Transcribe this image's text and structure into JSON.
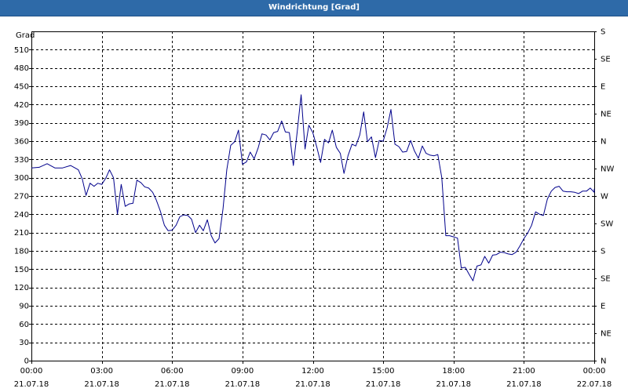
{
  "window": {
    "title": "Windrichtung [Grad]"
  },
  "chart_data": {
    "type": "line",
    "title": "Windrichtung [Grad]",
    "ylabel": "Grad",
    "ylim": [
      0,
      540
    ],
    "y_ticks": [
      0,
      30,
      60,
      90,
      120,
      150,
      180,
      210,
      240,
      270,
      300,
      330,
      360,
      390,
      420,
      450,
      480,
      510
    ],
    "xlim_hours": [
      0,
      24
    ],
    "x_ticks": [
      {
        "h": 0,
        "time": "00:00",
        "date": "21.07.18"
      },
      {
        "h": 3,
        "time": "03:00",
        "date": "21.07.18"
      },
      {
        "h": 6,
        "time": "06:00",
        "date": "21.07.18"
      },
      {
        "h": 9,
        "time": "09:00",
        "date": "21.07.18"
      },
      {
        "h": 12,
        "time": "12:00",
        "date": "21.07.18"
      },
      {
        "h": 15,
        "time": "15:00",
        "date": "21.07.18"
      },
      {
        "h": 18,
        "time": "18:00",
        "date": "21.07.18"
      },
      {
        "h": 21,
        "time": "21:00",
        "date": "21.07.18"
      },
      {
        "h": 24,
        "time": "00:00",
        "date": "22.07.18"
      }
    ],
    "right_axis": [
      {
        "v": 0,
        "label": "N"
      },
      {
        "v": 45,
        "label": "NE"
      },
      {
        "v": 90,
        "label": "E"
      },
      {
        "v": 135,
        "label": "SE"
      },
      {
        "v": 180,
        "label": "S"
      },
      {
        "v": 225,
        "label": "SW"
      },
      {
        "v": 270,
        "label": "W"
      },
      {
        "v": 315,
        "label": "NW"
      },
      {
        "v": 360,
        "label": "N"
      },
      {
        "v": 405,
        "label": "NE"
      },
      {
        "v": 450,
        "label": "E"
      },
      {
        "v": 495,
        "label": "SE"
      },
      {
        "v": 540,
        "label": "S"
      }
    ],
    "grid": true,
    "colors": {
      "line": "#00008b",
      "titlebar": "#2e6aa8"
    },
    "series": [
      {
        "points": [
          [
            0.0,
            316
          ],
          [
            0.33,
            317
          ],
          [
            0.67,
            323
          ],
          [
            1.0,
            316
          ],
          [
            1.33,
            316
          ],
          [
            1.67,
            320
          ],
          [
            2.0,
            313
          ],
          [
            2.17,
            298
          ],
          [
            2.33,
            271
          ],
          [
            2.5,
            291
          ],
          [
            2.67,
            286
          ],
          [
            2.83,
            291
          ],
          [
            3.0,
            289
          ],
          [
            3.17,
            299
          ],
          [
            3.33,
            313
          ],
          [
            3.5,
            300
          ],
          [
            3.67,
            240
          ],
          [
            3.83,
            289
          ],
          [
            4.0,
            253
          ],
          [
            4.17,
            257
          ],
          [
            4.33,
            258
          ],
          [
            4.5,
            296
          ],
          [
            4.67,
            292
          ],
          [
            4.83,
            285
          ],
          [
            5.0,
            283
          ],
          [
            5.17,
            276
          ],
          [
            5.33,
            263
          ],
          [
            5.5,
            245
          ],
          [
            5.67,
            222
          ],
          [
            5.83,
            213
          ],
          [
            6.0,
            214
          ],
          [
            6.17,
            222
          ],
          [
            6.33,
            236
          ],
          [
            6.5,
            239
          ],
          [
            6.67,
            238
          ],
          [
            6.83,
            232
          ],
          [
            7.0,
            210
          ],
          [
            7.17,
            222
          ],
          [
            7.33,
            213
          ],
          [
            7.5,
            231
          ],
          [
            7.67,
            205
          ],
          [
            7.83,
            193
          ],
          [
            8.0,
            200
          ],
          [
            8.17,
            249
          ],
          [
            8.33,
            313
          ],
          [
            8.5,
            353
          ],
          [
            8.67,
            359
          ],
          [
            8.83,
            378
          ],
          [
            9.0,
            322
          ],
          [
            9.17,
            326
          ],
          [
            9.33,
            342
          ],
          [
            9.5,
            331
          ],
          [
            9.67,
            349
          ],
          [
            9.83,
            372
          ],
          [
            10.0,
            370
          ],
          [
            10.17,
            362
          ],
          [
            10.33,
            374
          ],
          [
            10.5,
            376
          ],
          [
            10.67,
            393
          ],
          [
            10.83,
            375
          ],
          [
            11.0,
            374
          ],
          [
            11.17,
            320
          ],
          [
            11.33,
            374
          ],
          [
            11.5,
            436
          ],
          [
            11.67,
            347
          ],
          [
            11.83,
            386
          ],
          [
            12.0,
            374
          ],
          [
            12.17,
            350
          ],
          [
            12.33,
            325
          ],
          [
            12.5,
            363
          ],
          [
            12.67,
            357
          ],
          [
            12.83,
            378
          ],
          [
            13.0,
            350
          ],
          [
            13.17,
            340
          ],
          [
            13.33,
            307
          ],
          [
            13.5,
            336
          ],
          [
            13.67,
            355
          ],
          [
            13.83,
            352
          ],
          [
            14.0,
            370
          ],
          [
            14.17,
            408
          ],
          [
            14.33,
            359
          ],
          [
            14.5,
            367
          ],
          [
            14.67,
            333
          ],
          [
            14.83,
            361
          ],
          [
            15.0,
            360
          ],
          [
            15.17,
            382
          ],
          [
            15.33,
            412
          ],
          [
            15.5,
            355
          ],
          [
            15.67,
            351
          ],
          [
            15.83,
            342
          ],
          [
            16.0,
            343
          ],
          [
            16.17,
            361
          ],
          [
            16.33,
            344
          ],
          [
            16.5,
            332
          ],
          [
            16.67,
            352
          ],
          [
            16.83,
            340
          ],
          [
            17.0,
            337
          ],
          [
            17.17,
            336
          ],
          [
            17.33,
            338
          ],
          [
            17.5,
            300
          ],
          [
            17.67,
            205
          ],
          [
            17.83,
            205
          ],
          [
            18.0,
            203
          ],
          [
            18.17,
            201
          ],
          [
            18.33,
            152
          ],
          [
            18.5,
            153
          ],
          [
            18.67,
            141
          ],
          [
            18.83,
            131
          ],
          [
            19.0,
            155
          ],
          [
            19.17,
            157
          ],
          [
            19.33,
            171
          ],
          [
            19.5,
            160
          ],
          [
            19.67,
            173
          ],
          [
            19.83,
            174
          ],
          [
            20.0,
            178
          ],
          [
            20.17,
            177
          ],
          [
            20.33,
            175
          ],
          [
            20.5,
            174
          ],
          [
            20.67,
            178
          ],
          [
            20.83,
            188
          ],
          [
            21.0,
            200
          ],
          [
            21.17,
            210
          ],
          [
            21.33,
            222
          ],
          [
            21.5,
            244
          ],
          [
            21.67,
            240
          ],
          [
            21.83,
            238
          ],
          [
            22.0,
            265
          ],
          [
            22.17,
            278
          ],
          [
            22.33,
            284
          ],
          [
            22.5,
            286
          ],
          [
            22.67,
            278
          ],
          [
            22.83,
            277
          ],
          [
            23.0,
            277
          ],
          [
            23.17,
            276
          ],
          [
            23.33,
            274
          ],
          [
            23.5,
            278
          ],
          [
            23.67,
            278
          ],
          [
            23.83,
            283
          ],
          [
            24.0,
            276
          ],
          [
            24.17,
            280
          ],
          [
            24.33,
            282
          ]
        ]
      }
    ]
  }
}
